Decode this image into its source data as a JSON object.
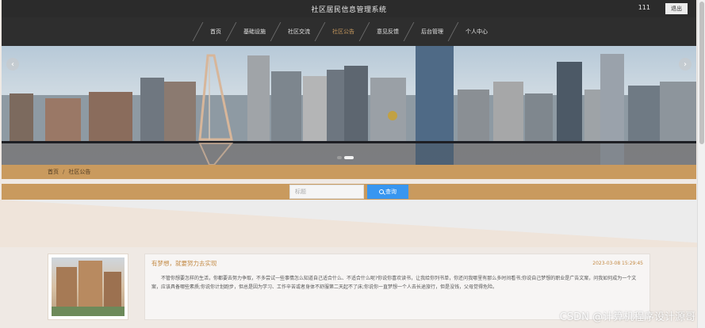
{
  "header": {
    "site_title": "社区居民信息管理系统",
    "username": "111",
    "logout_label": "退出"
  },
  "nav": {
    "items": [
      {
        "label": "首页"
      },
      {
        "label": "基础设施"
      },
      {
        "label": "社区交流"
      },
      {
        "label": "社区公告"
      },
      {
        "label": "意见反馈"
      },
      {
        "label": "后台管理"
      },
      {
        "label": "个人中心"
      }
    ],
    "active_index": 3
  },
  "banner": {
    "prev_icon": "chevron-left-icon",
    "next_icon": "chevron-right-icon",
    "slide_count": 2,
    "active_slide": 1
  },
  "breadcrumb": {
    "home": "首页",
    "current": "社区公告"
  },
  "search": {
    "placeholder": "标题",
    "button_label": "查询"
  },
  "notices": [
    {
      "title": "有梦想，就要努力去实现",
      "date": "2023-03-08 15:29:45",
      "summary": "不管你想要怎样的生活，你都要去努力争取，不多尝试一些事情怎么知道自己适合什么、不适合什么呢?你说你喜欢读书，让我给你列书单，你还问我哪里有那么多时间看书;你说自己梦想的职业是广告文案，问我如何成为一个文案，应该具备哪些素质;你说你计划跑步，但总是因为学习、工作辛苦或者身体不舒服第二天起不了床;你说你一直梦想一个人去长途旅行，但是没钱，父母觉得危险。"
    }
  ],
  "watermark": "CSDN @计算机程序设计源哥",
  "colors": {
    "accent": "#c99a5e",
    "header_bg": "#2b2b2b",
    "button_blue": "#3896f0"
  }
}
